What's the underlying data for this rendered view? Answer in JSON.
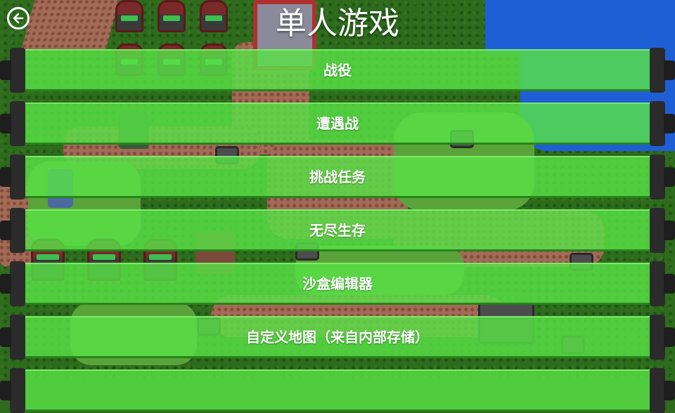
{
  "header": {
    "title": "单人游戏",
    "back_icon": "back-arrow-icon"
  },
  "menu": {
    "items": [
      {
        "id": "campaign",
        "label": "战役"
      },
      {
        "id": "skirmish",
        "label": "遭遇战"
      },
      {
        "id": "challenge",
        "label": "挑战任务"
      },
      {
        "id": "survival",
        "label": "无尽生存"
      },
      {
        "id": "sandbox",
        "label": "沙盒编辑器"
      },
      {
        "id": "custom-map",
        "label": "自定义地图（来自内部存储）"
      },
      {
        "id": "partial",
        "label": ""
      }
    ]
  },
  "colors": {
    "button_green": "#58e246",
    "water": "#1f5fd6",
    "grass": "#2e6b1d",
    "dirt": "#a36a58",
    "text": "#ffffff"
  }
}
